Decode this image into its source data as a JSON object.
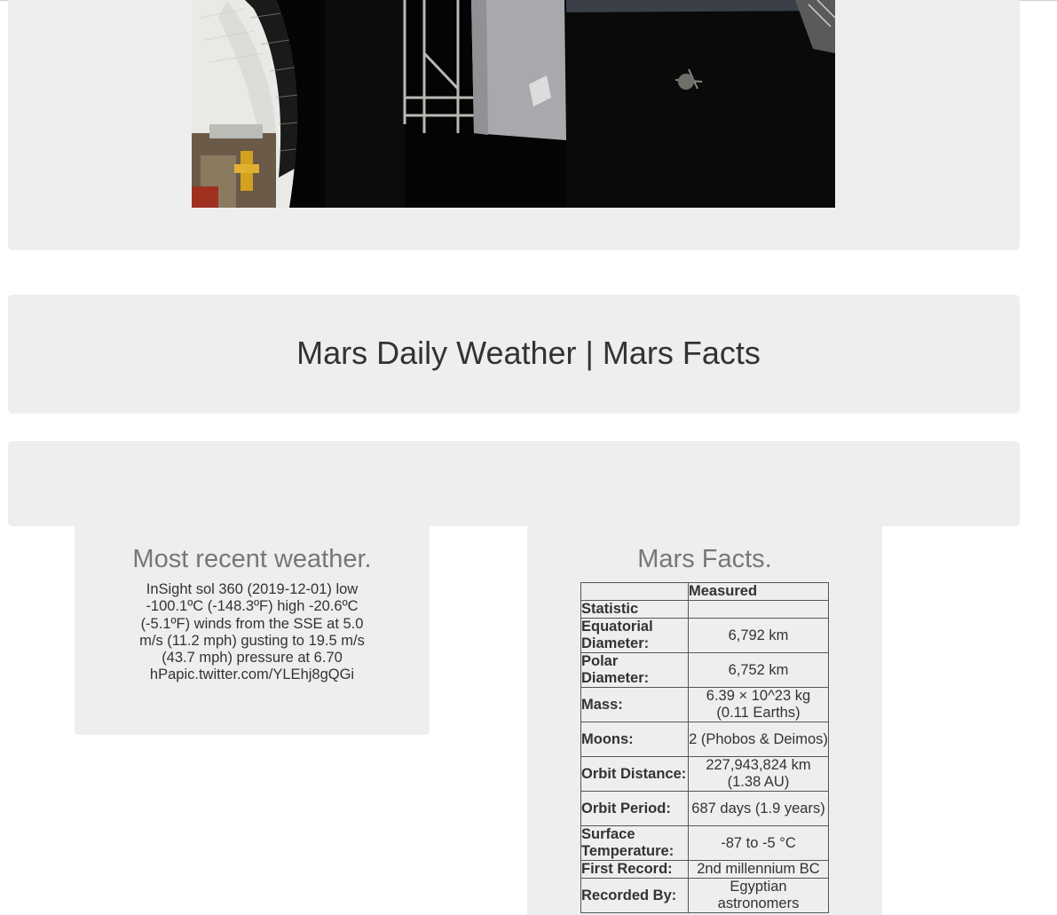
{
  "header": {
    "title": "Mars Daily Weather | Mars Facts"
  },
  "featured_image": {
    "alt": "Featured spacecraft image"
  },
  "weather": {
    "heading": "Most recent weather.",
    "tweet": "InSight sol 360 (2019-12-01) low -100.1ºC (-148.3ºF) high -20.6ºC (-5.1ºF) winds from the SSE at 5.0 m/s (11.2 mph) gusting to 19.5 m/s (43.7 mph) pressure at 6.70 hPapic.twitter.com/YLEhj8gQGi"
  },
  "facts": {
    "heading": "Mars Facts.",
    "columns": [
      "",
      "Measured"
    ],
    "index_label": "Statistic",
    "rows": [
      {
        "label": "Equatorial Diameter:",
        "value": "6,792 km"
      },
      {
        "label": "Polar Diameter:",
        "value": "6,752 km"
      },
      {
        "label": "Mass:",
        "value": "6.39 × 10^23 kg (0.11 Earths)"
      },
      {
        "label": "Moons:",
        "value": "2 (Phobos & Deimos)"
      },
      {
        "label": "Orbit Distance:",
        "value": "227,943,824 km (1.38 AU)"
      },
      {
        "label": "Orbit Period:",
        "value": "687 days (1.9 years)"
      },
      {
        "label": "Surface Temperature:",
        "value": "-87 to -5 °C"
      },
      {
        "label": "First Record:",
        "value": "2nd millennium BC"
      },
      {
        "label": "Recorded By:",
        "value": "Egyptian astronomers"
      }
    ]
  },
  "colors": {
    "panel_bg": "#eeeeee",
    "heading_gray": "#777777",
    "text": "#333333"
  }
}
